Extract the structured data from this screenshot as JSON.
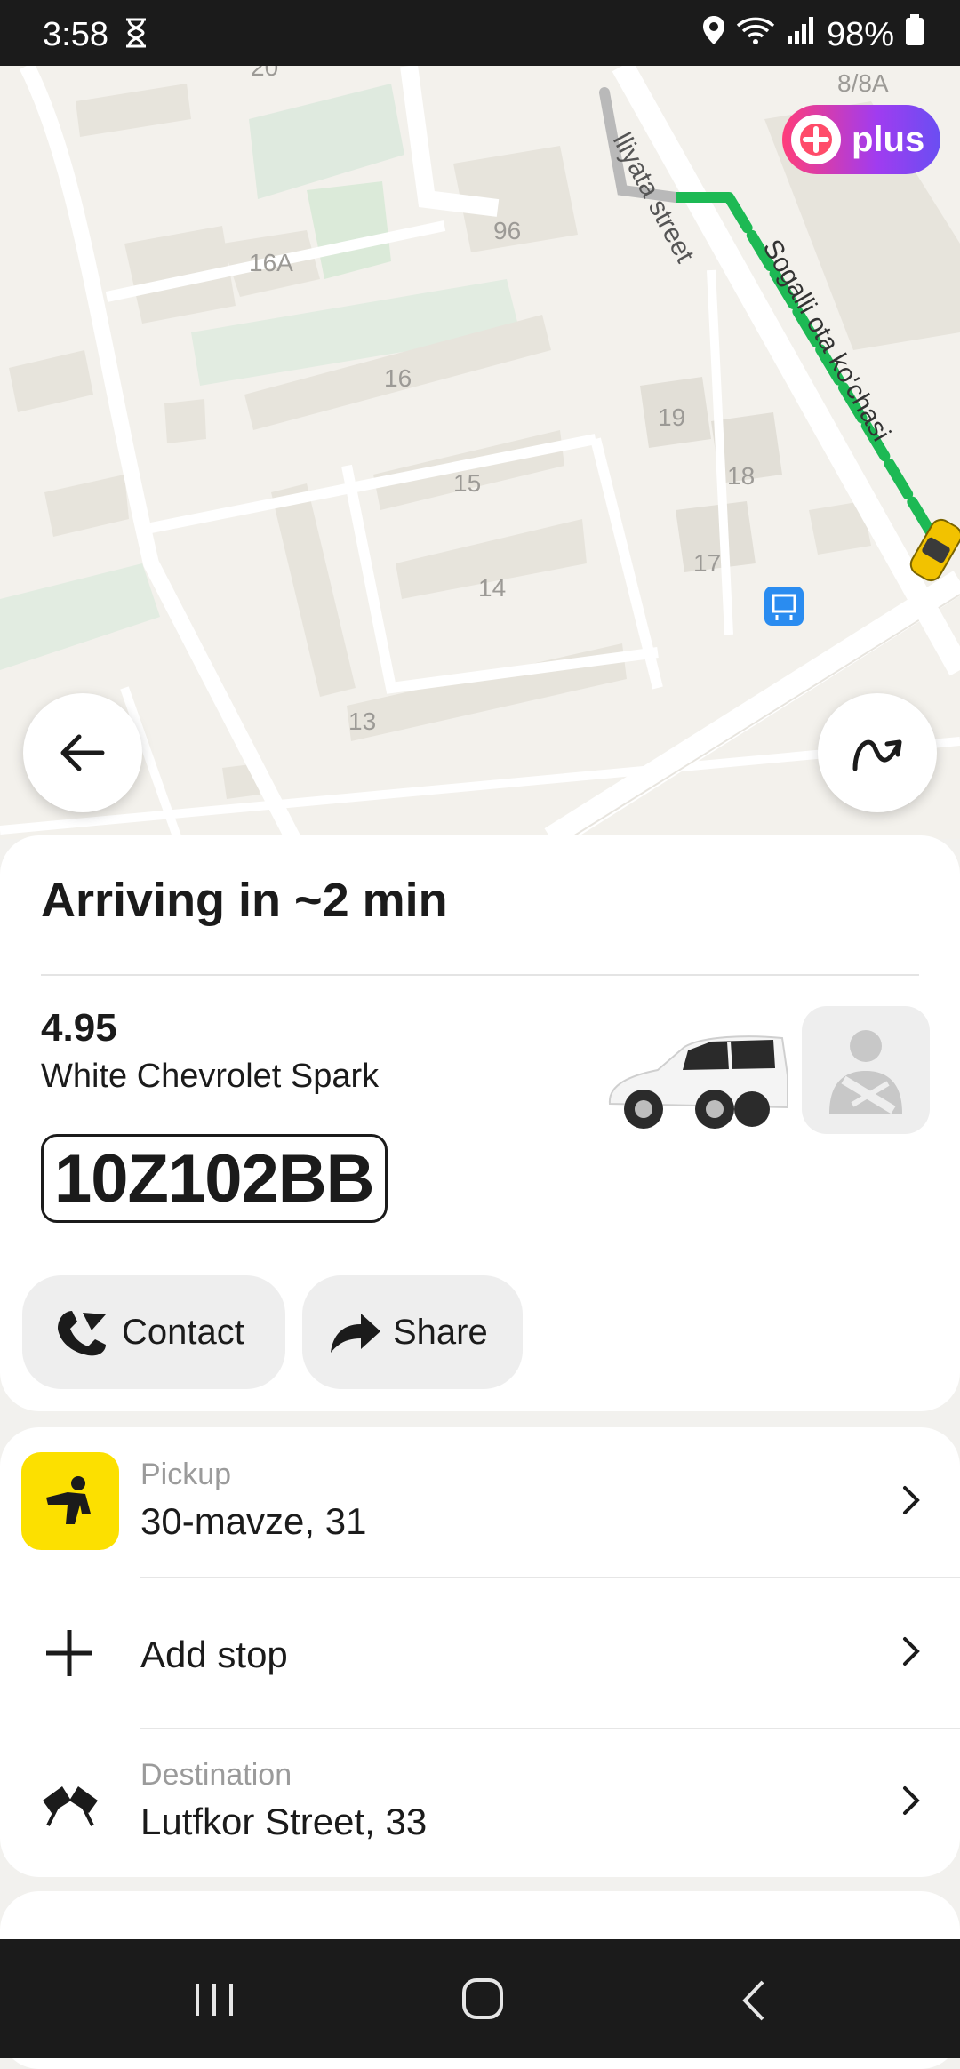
{
  "status_bar": {
    "time": "3:58",
    "battery": "98%"
  },
  "map": {
    "street_labels": [
      "lliyata street",
      "Sogalli ota ko'chasi"
    ],
    "building_labels": [
      "16A",
      "96",
      "16",
      "19",
      "18",
      "15",
      "17",
      "14",
      "13",
      "8/8A",
      "20"
    ],
    "plus_label": "plus"
  },
  "trip": {
    "eta_title": "Arriving in ~2 min",
    "rating": "4.95",
    "car": "White Chevrolet Spark",
    "plate": "10Z102BB",
    "contact_label": "Contact",
    "share_label": "Share"
  },
  "route": {
    "pickup_label": "Pickup",
    "pickup_address": "30-mavze, 31",
    "add_stop_label": "Add stop",
    "destination_label": "Destination",
    "destination_address": "Lutfkor Street, 33"
  },
  "colors": {
    "accent_yellow": "#fce000",
    "route_green": "#1db954"
  }
}
